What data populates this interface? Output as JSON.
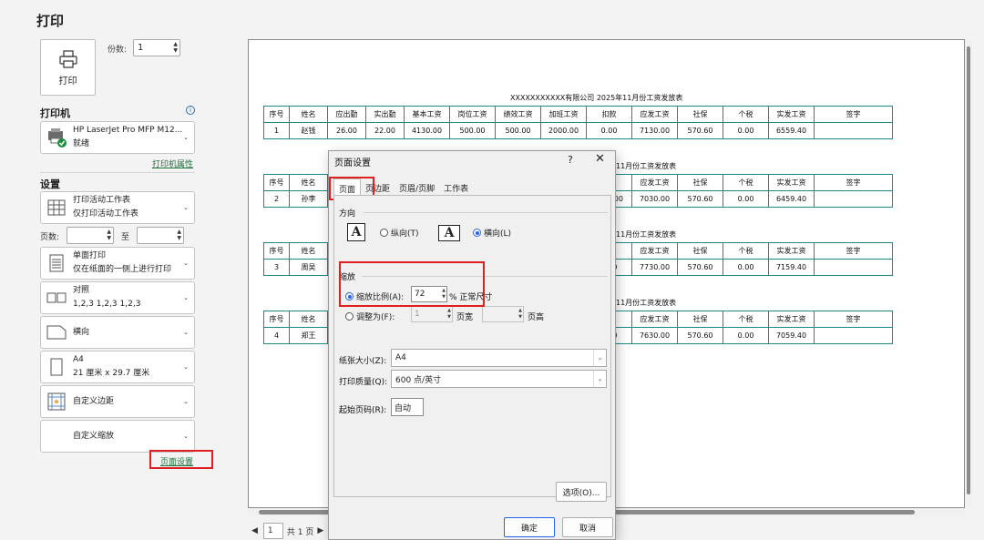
{
  "page_title": "打印",
  "print_button_label": "打印",
  "copies": {
    "label": "份数:",
    "value": "1"
  },
  "printer": {
    "section": "打印机",
    "info_glyph": "i",
    "name": "HP LaserJet Pro MFP M12...",
    "status": "就绪",
    "properties_link": "打印机属性"
  },
  "settings": {
    "section": "设置",
    "scope": {
      "line1": "打印活动工作表",
      "line2": "仅打印活动工作表"
    },
    "pages": {
      "label": "页数:",
      "to": "至"
    },
    "sides": {
      "line1": "单面打印",
      "line2": "仅在纸面的一侧上进行打印"
    },
    "collate": {
      "line1": "对照",
      "line2": "1,2,3    1,2,3    1,2,3"
    },
    "orientation": "横向",
    "paper": {
      "line1": "A4",
      "line2": "21 厘米 x 29.7 厘米"
    },
    "margins": "自定义边距",
    "scaling": "自定义缩放",
    "page_setup_link": "页面设置"
  },
  "pager": {
    "page": "1",
    "total": "共 1 页"
  },
  "preview": {
    "headers": [
      "序号",
      "姓名",
      "应出勤",
      "实出勤",
      "基本工资",
      "岗位工资",
      "绩效工资",
      "加班工资",
      "扣款",
      "应发工资",
      "社保",
      "个税",
      "实发工资",
      "签字"
    ],
    "title_full": "XXXXXXXXXXX有限公司 2025年11月份工资发放表",
    "title_partial": "11月份工资发放表",
    "rows": [
      [
        "1",
        "赵钱",
        "26.00",
        "22.00",
        "4130.00",
        "500.00",
        "500.00",
        "2000.00",
        "0.00",
        "7130.00",
        "570.60",
        "0.00",
        "6559.40",
        ""
      ],
      [
        "2",
        "孙李",
        "",
        "",
        "",
        "",
        "",
        "",
        "-500.00",
        "7030.00",
        "570.60",
        "0.00",
        "6459.40",
        ""
      ],
      [
        "3",
        "周吴",
        "",
        "",
        "",
        "",
        "",
        "",
        "0.00",
        "7730.00",
        "570.60",
        "0.00",
        "7159.40",
        ""
      ],
      [
        "4",
        "郑王",
        "",
        "",
        "",
        "",
        "",
        "",
        "0.00",
        "7630.00",
        "570.60",
        "0.00",
        "7059.40",
        ""
      ]
    ]
  },
  "dialog": {
    "title": "页面设置",
    "help": "?",
    "close": "✕",
    "tabs": [
      "页面",
      "页边距",
      "页眉/页脚",
      "工作表"
    ],
    "orientation_group": "方向",
    "orientation_glyph": "A",
    "portrait": "纵向(T)",
    "landscape": "横向(L)",
    "scaling_group": "缩放",
    "adjust_to": "缩放比例(A):",
    "adjust_value": "72",
    "adjust_suffix": "% 正常尺寸",
    "fit_to": "调整为(F):",
    "fit_wide_value": "1",
    "fit_wide_label": "页宽",
    "fit_tall_label": "页高",
    "paper_size_label": "纸张大小(Z):",
    "paper_size_value": "A4",
    "quality_label": "打印质量(Q):",
    "quality_value": "600 点/英寸",
    "first_page_label": "起始页码(R):",
    "first_page_value": "自动",
    "options_button": "选项(O)...",
    "ok": "确定",
    "cancel": "取消"
  }
}
